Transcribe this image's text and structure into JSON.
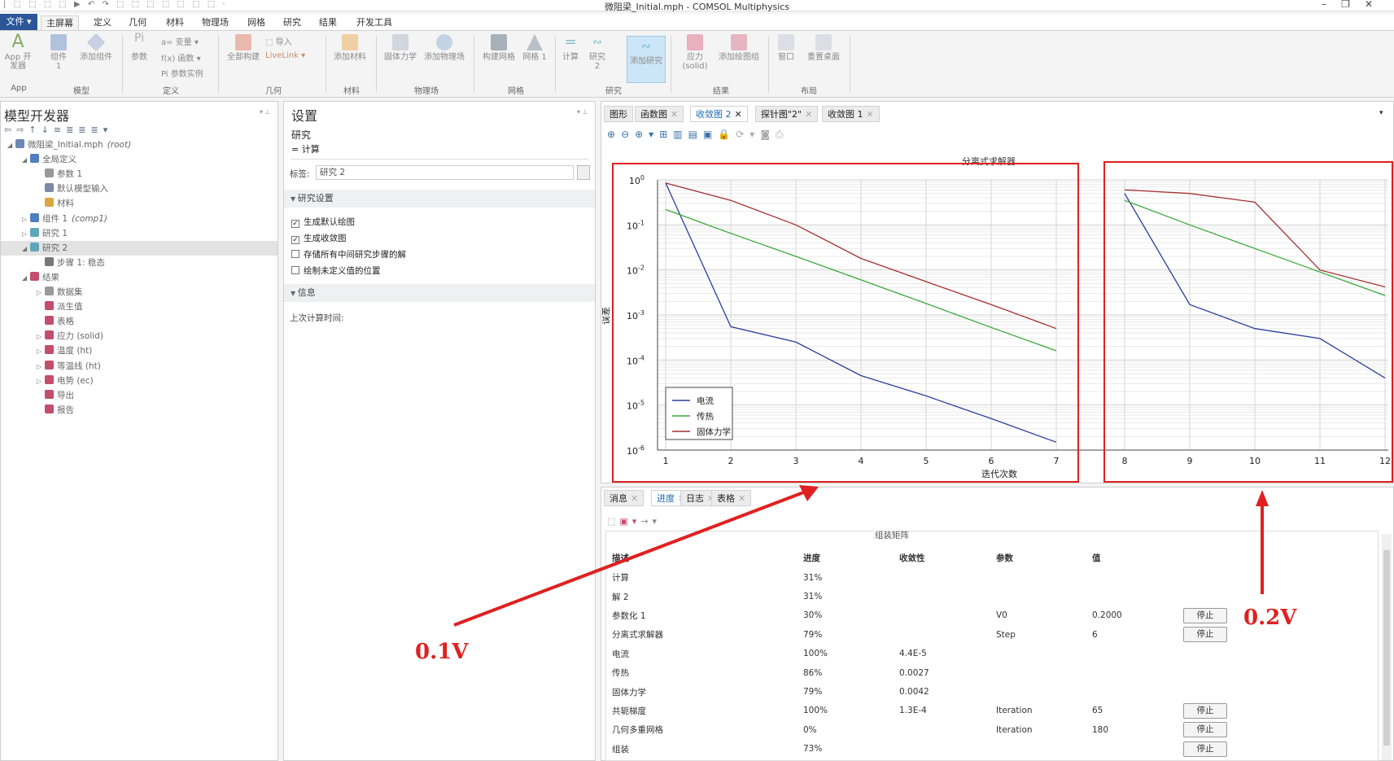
{
  "app": {
    "title": "微阻梁_Initial.mph - COMSOL Multiphysics",
    "quick_access": "| ⬚ ⬚ ⬚ ⬚ ▶ ↶ ↷ ⬚ ⬚ ⬚ ⬚ ⬚ ⬚ ⬚ ·"
  },
  "menu": {
    "file": "文件 ▾",
    "tabs": [
      "主屏幕",
      "定义",
      "几何",
      "材料",
      "物理场",
      "网格",
      "研究",
      "结果",
      "开发工具"
    ]
  },
  "ribbon": {
    "groups": [
      "App",
      "模型",
      "定义",
      "几何",
      "材料",
      "物理场",
      "网格",
      "研究",
      "结果",
      "布局"
    ],
    "buttons": [
      "App 开发器",
      "组件 1",
      "添加组件",
      "参数",
      "全部构建",
      "添加材料",
      "固体力学",
      "添加物理场",
      "构建网格",
      "网格 1",
      "计算",
      "研究 2",
      "添加研究",
      "应力 (solid)",
      "添加绘图组",
      "窗口",
      "重置桌面"
    ],
    "small": [
      "a= 变量 ▾",
      "f(x) 函数 ▾",
      "Pi 参数实例",
      "⬚ 导入",
      "LiveLink ▾"
    ]
  },
  "model_builder": {
    "title": "模型开发器",
    "tree": [
      {
        "label": "微阻梁_Initial.mph",
        "suffix": "(root)",
        "icon": "file-icon",
        "color": "#6a87b5"
      },
      {
        "label": "全局定义",
        "icon": "globe-icon",
        "color": "#4f7fbf"
      },
      {
        "label": "参数 1",
        "icon": "parameter-icon",
        "color": "#999"
      },
      {
        "label": "默认模型输入",
        "icon": "model-input-icon",
        "color": "#7c8aa8"
      },
      {
        "label": "材料",
        "icon": "material-icon",
        "color": "#d9a642"
      },
      {
        "label": "组件 1",
        "suffix": "(comp1)",
        "icon": "component-icon",
        "color": "#4f7fbf"
      },
      {
        "label": "研究 1",
        "icon": "study-icon",
        "color": "#5fa7b8"
      },
      {
        "label": "研究 2",
        "icon": "study-icon",
        "color": "#5fa7b8"
      },
      {
        "label": "步骤 1: 稳态",
        "icon": "step-icon",
        "color": "#777"
      },
      {
        "label": "结果",
        "icon": "results-icon",
        "color": "#c44d6b"
      },
      {
        "label": "数据集",
        "icon": "dataset-icon",
        "color": "#999"
      },
      {
        "label": "派生值",
        "icon": "derived-values-icon",
        "color": "#c44d6b"
      },
      {
        "label": "表格",
        "icon": "table-icon",
        "color": "#c44d6b"
      },
      {
        "label": "应力 (solid)",
        "icon": "plot-group-icon",
        "color": "#c44d6b"
      },
      {
        "label": "温度 (ht)",
        "icon": "plot-group-icon",
        "color": "#c44d6b"
      },
      {
        "label": "等温线 (ht)",
        "icon": "plot-group-icon",
        "color": "#c44d6b"
      },
      {
        "label": "电势 (ec)",
        "icon": "plot-group-icon",
        "color": "#c44d6b"
      },
      {
        "label": "导出",
        "icon": "export-icon",
        "color": "#c44d6b"
      },
      {
        "label": "报告",
        "icon": "report-icon",
        "color": "#c44d6b"
      }
    ]
  },
  "settings": {
    "title": "设置",
    "subtitle": "研究",
    "compute": "= 计算",
    "label_caption": "标签:",
    "label_value": "研究 2",
    "section_study": "研究设置",
    "checkboxes": [
      {
        "label": "生成默认绘图",
        "checked": "✓"
      },
      {
        "label": "生成收敛图",
        "checked": "✓"
      },
      {
        "label": "存储所有中间研究步骤的解",
        "checked": ""
      },
      {
        "label": "绘制未定义值的位置",
        "checked": ""
      }
    ],
    "section_info": "信息",
    "last_time": "上次计算时间:"
  },
  "graphics": {
    "tabs": [
      "图形",
      "函数图",
      "收敛图 2",
      "探针图\"2\"",
      "收敛图 1"
    ],
    "close": "✕"
  },
  "chart_data": {
    "type": "line",
    "title": "分离式求解器",
    "xlabel": "迭代次数",
    "ylabel": "误差",
    "yscale": "log",
    "ylim": [
      1e-06,
      1
    ],
    "grid": true,
    "legend": "bottom-left",
    "x": [
      1,
      2,
      3,
      4,
      5,
      6,
      7,
      8,
      9,
      10,
      11,
      12
    ],
    "x_ticks": [
      "1",
      "2",
      "3",
      "4",
      "5",
      "6",
      "7",
      "8",
      "9",
      "10",
      "11",
      "12"
    ],
    "y_ticks": [
      {
        "b": "10",
        "e": "0"
      },
      {
        "b": "10",
        "e": "-1"
      },
      {
        "b": "10",
        "e": "-2"
      },
      {
        "b": "10",
        "e": "-3"
      },
      {
        "b": "10",
        "e": "-4"
      },
      {
        "b": "10",
        "e": "-5"
      },
      {
        "b": "10",
        "e": "-6"
      }
    ],
    "series": [
      {
        "name": "电流",
        "color": "#2a3f9e",
        "points": [
          [
            1,
            0.85
          ],
          [
            2,
            0.00055
          ],
          [
            3,
            0.00025
          ],
          [
            4,
            4.5e-05
          ],
          [
            5,
            1.6e-05
          ],
          [
            6,
            5e-06
          ],
          [
            7,
            1.5e-06
          ],
          null,
          [
            8,
            0.5
          ],
          [
            9,
            0.0017
          ],
          [
            10,
            0.0005
          ],
          [
            11,
            0.0003
          ],
          [
            12,
            4e-05
          ]
        ]
      },
      {
        "name": "传热",
        "color": "#3aa83a",
        "points": [
          [
            1,
            0.22
          ],
          [
            2,
            0.065
          ],
          [
            3,
            0.02
          ],
          [
            4,
            0.006
          ],
          [
            5,
            0.0018
          ],
          [
            6,
            0.00053
          ],
          [
            7,
            0.00016
          ],
          null,
          [
            8,
            0.35
          ],
          [
            9,
            0.1
          ],
          [
            10,
            0.03
          ],
          [
            11,
            0.009
          ],
          [
            12,
            0.0027
          ]
        ]
      },
      {
        "name": "固体力学",
        "color": "#a33030",
        "points": [
          [
            1,
            0.85
          ],
          [
            2,
            0.35
          ],
          [
            3,
            0.1
          ],
          [
            4,
            0.018
          ],
          [
            5,
            0.0055
          ],
          [
            6,
            0.0017
          ],
          [
            7,
            0.0005
          ],
          null,
          [
            8,
            0.6
          ],
          [
            9,
            0.5
          ],
          [
            10,
            0.32
          ],
          [
            11,
            0.01
          ],
          [
            12,
            0.0042
          ]
        ]
      }
    ]
  },
  "annotations": {
    "left": "0.1V",
    "right": "0.2V",
    "color": "#e02020"
  },
  "bottom": {
    "tabs": [
      "消息",
      "进度",
      "日志",
      "表格"
    ],
    "section": "组装矩阵",
    "headers": [
      "描述",
      "进度",
      "收敛性",
      "参数",
      "值"
    ],
    "rows": [
      {
        "desc": "计算",
        "progress": "31%",
        "conv": "",
        "param": "",
        "value": "",
        "btn": ""
      },
      {
        "desc": "解 2",
        "progress": "31%",
        "conv": "",
        "param": "",
        "value": "",
        "btn": ""
      },
      {
        "desc": "参数化 1",
        "progress": "30%",
        "conv": "",
        "param": "V0",
        "value": "0.2000",
        "btn": "停止"
      },
      {
        "desc": "分离式求解器",
        "progress": "79%",
        "conv": "",
        "param": "Step",
        "value": "6",
        "btn": "停止"
      },
      {
        "desc": "电流",
        "progress": "100%",
        "conv": "4.4E-5",
        "param": "",
        "value": "",
        "btn": ""
      },
      {
        "desc": "传热",
        "progress": "86%",
        "conv": "0.0027",
        "param": "",
        "value": "",
        "btn": ""
      },
      {
        "desc": "固体力学",
        "progress": "79%",
        "conv": "0.0042",
        "param": "",
        "value": "",
        "btn": ""
      },
      {
        "desc": "共轭梯度",
        "progress": "100%",
        "conv": "1.3E-4",
        "param": "Iteration",
        "value": "65",
        "btn": "停止"
      },
      {
        "desc": "几何多重网格",
        "progress": "0%",
        "conv": "",
        "param": "Iteration",
        "value": "180",
        "btn": "停止"
      },
      {
        "desc": "组装",
        "progress": "73%",
        "conv": "",
        "param": "",
        "value": "",
        "btn": "停止"
      }
    ]
  }
}
